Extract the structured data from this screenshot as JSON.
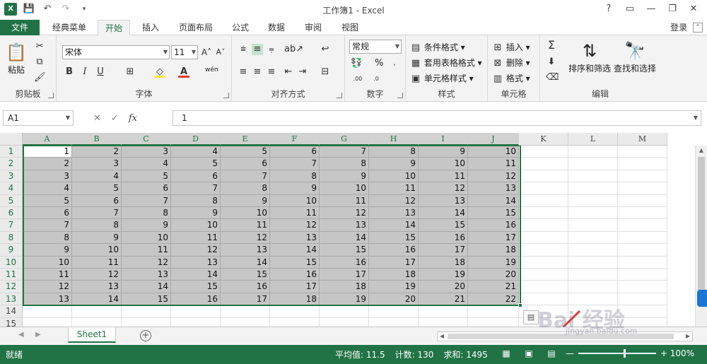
{
  "window": {
    "title": "工作簿1 - Excel",
    "app_icon": "X",
    "controls": [
      "?",
      "▭",
      "—",
      "❐",
      "✕"
    ]
  },
  "tabs": {
    "file": "文件",
    "items": [
      "经典菜单",
      "开始",
      "插入",
      "页面布局",
      "公式",
      "数据",
      "审阅",
      "视图"
    ],
    "active": "开始",
    "login": "登录"
  },
  "ribbon": {
    "clipboard": {
      "paste": "粘贴",
      "label": "剪贴板"
    },
    "font": {
      "name": "宋体",
      "size": "11",
      "label": "字体",
      "bold": "B",
      "italic": "I",
      "underline": "U",
      "wen": "wén"
    },
    "alignment": {
      "label": "对齐方式"
    },
    "number": {
      "format": "常规",
      "label": "数字",
      "percent": "%"
    },
    "styles": {
      "conditional": "条件格式",
      "table": "套用表格格式",
      "cell": "单元格样式",
      "label": "样式"
    },
    "cells": {
      "insert": "插入",
      "delete": "删除",
      "format": "格式",
      "label": "单元格"
    },
    "editing": {
      "sort": "排序和筛选",
      "find": "查找和选择",
      "label": "编辑"
    }
  },
  "formula_bar": {
    "name_box": "A1",
    "value": "1",
    "fx": "fx"
  },
  "grid": {
    "columns": [
      "A",
      "B",
      "C",
      "D",
      "E",
      "F",
      "G",
      "H",
      "I",
      "J",
      "K",
      "L",
      "M"
    ],
    "rows": [
      "1",
      "2",
      "3",
      "4",
      "5",
      "6",
      "7",
      "8",
      "9",
      "10",
      "11",
      "12",
      "13",
      "14",
      "15"
    ],
    "selected_columns": 10,
    "selected_rows": 13,
    "data": [
      [
        1,
        2,
        3,
        4,
        5,
        6,
        7,
        8,
        9,
        10
      ],
      [
        2,
        3,
        4,
        5,
        6,
        7,
        8,
        9,
        10,
        11
      ],
      [
        3,
        4,
        5,
        6,
        7,
        8,
        9,
        10,
        11,
        12
      ],
      [
        4,
        5,
        6,
        7,
        8,
        9,
        10,
        11,
        12,
        13
      ],
      [
        5,
        6,
        7,
        8,
        9,
        10,
        11,
        12,
        13,
        14
      ],
      [
        6,
        7,
        8,
        9,
        10,
        11,
        12,
        13,
        14,
        15
      ],
      [
        7,
        8,
        9,
        10,
        11,
        12,
        13,
        14,
        15,
        16
      ],
      [
        8,
        9,
        10,
        11,
        12,
        13,
        14,
        15,
        16,
        17
      ],
      [
        9,
        10,
        11,
        12,
        13,
        14,
        15,
        16,
        17,
        18
      ],
      [
        10,
        11,
        12,
        13,
        14,
        15,
        16,
        17,
        18,
        19
      ],
      [
        11,
        12,
        13,
        14,
        15,
        16,
        17,
        18,
        19,
        20
      ],
      [
        12,
        13,
        14,
        15,
        16,
        17,
        18,
        19,
        20,
        21
      ],
      [
        13,
        14,
        15,
        16,
        17,
        18,
        19,
        20,
        21,
        22
      ]
    ]
  },
  "sheets": {
    "tabs": [
      "Sheet1"
    ],
    "active": "Sheet1"
  },
  "status": {
    "ready": "就绪",
    "average": "平均值: 11.5",
    "count": "计数: 130",
    "sum": "求和: 1495",
    "zoom": "100%"
  },
  "watermark": {
    "text": "Bai 经验",
    "url": "jingyan.baidu.com"
  },
  "colors": {
    "accent": "#217346",
    "selection": "#c6c6c6",
    "arrow": "#e53935"
  }
}
